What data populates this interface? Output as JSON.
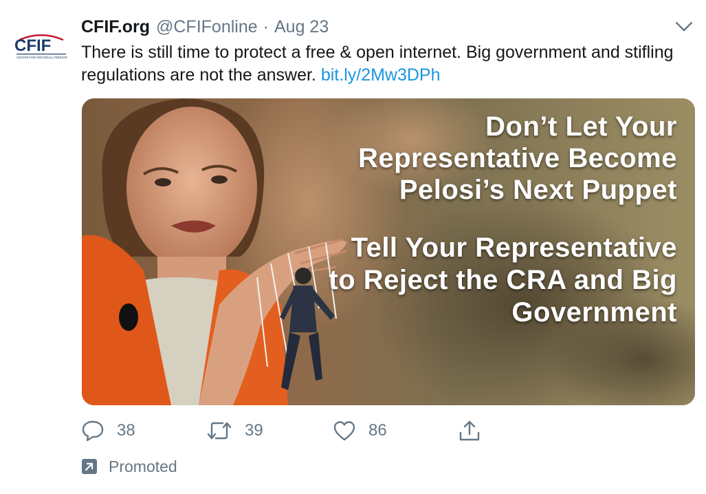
{
  "tweet": {
    "display_name": "CFIF.org",
    "handle": "@CFIFonline",
    "separator": "·",
    "date": "Aug 23",
    "text": "There is still time to protect a free & open internet. Big government and stifling regulations are not the answer.",
    "link": "bit.ly/2Mw3DPh"
  },
  "avatar": {
    "logo_text": "CFIF",
    "logo_subtext": "CENTER FOR INDIVIDUAL FREEDOM",
    "accent_color": "#c8102e",
    "brand_color": "#1d3a6b"
  },
  "media": {
    "headline_lines": [
      "Don’t Let Your",
      "Representative Become",
      "Pelosi’s Next Puppet"
    ],
    "cta_lines": [
      "Tell Your Representative",
      "to Reject the CRA and Big",
      "Government"
    ]
  },
  "actions": {
    "reply_count": "38",
    "retweet_count": "39",
    "like_count": "86"
  },
  "promoted_label": "Promoted",
  "icons": [
    "chevron-down-icon",
    "reply-icon",
    "retweet-icon",
    "like-icon",
    "share-icon",
    "promoted-icon"
  ],
  "colors": {
    "link": "#1b95e0",
    "secondary_text": "#657786",
    "primary_text": "#14171a"
  }
}
